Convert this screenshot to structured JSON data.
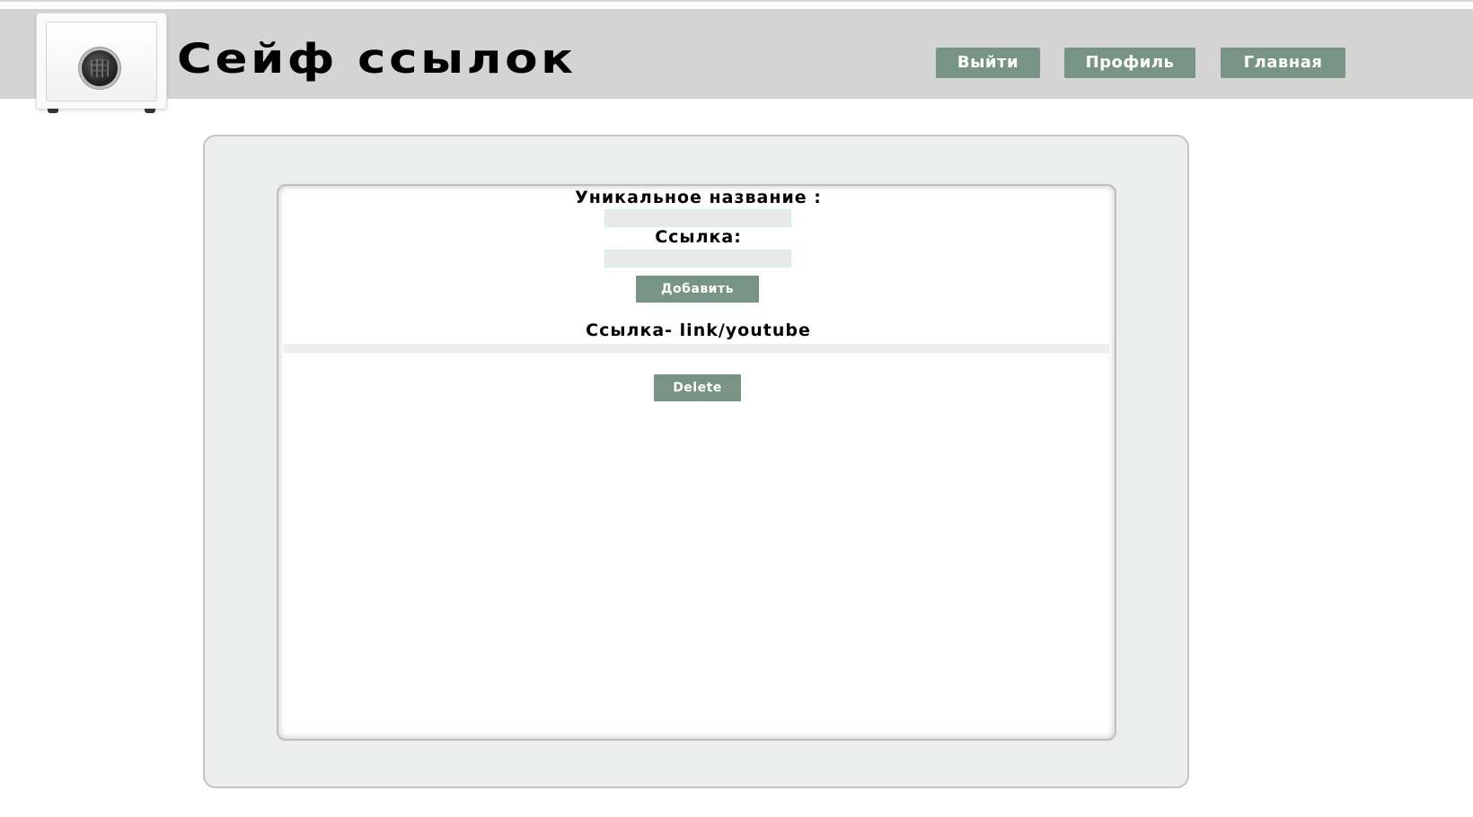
{
  "header": {
    "title": "Сейф ссылок",
    "nav": {
      "logout_label": "Выйти",
      "profile_label": "Профиль",
      "home_label": "Главная"
    }
  },
  "form": {
    "name_label": "Уникальное название :",
    "name_value": "",
    "link_label": "Ссылка:",
    "link_value": "",
    "add_button": "Добавить"
  },
  "entries": [
    {
      "text": "Ссылка- link/youtube",
      "delete_button": "Delete"
    }
  ],
  "colors": {
    "header_bg": "#d4d4d4",
    "button_bg": "#789485",
    "panel_bg": "#eceeed"
  }
}
